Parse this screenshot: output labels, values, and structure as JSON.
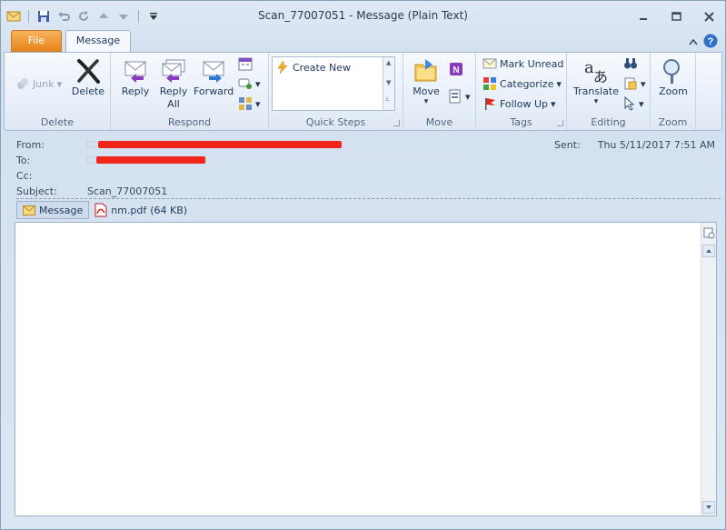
{
  "window": {
    "title": "Scan_77007051  -  Message (Plain Text)"
  },
  "tabs": {
    "file": "File",
    "message": "Message"
  },
  "ribbon": {
    "delete_group": {
      "label": "Delete",
      "junk": "Junk",
      "delete": "Delete"
    },
    "respond_group": {
      "label": "Respond",
      "reply": "Reply",
      "reply_all_1": "Reply",
      "reply_all_2": "All",
      "forward": "Forward"
    },
    "quick_steps_group": {
      "label": "Quick Steps",
      "create_new": "Create New"
    },
    "move_group": {
      "label": "Move",
      "move": "Move"
    },
    "tags_group": {
      "label": "Tags",
      "mark_unread": "Mark Unread",
      "categorize": "Categorize",
      "follow_up": "Follow Up"
    },
    "editing_group": {
      "label": "Editing",
      "translate": "Translate"
    },
    "zoom_group": {
      "label": "Zoom",
      "zoom": "Zoom"
    }
  },
  "header": {
    "from_label": "From:",
    "to_label": "To:",
    "cc_label": "Cc:",
    "subject_label": "Subject:",
    "subject": "Scan_77007051",
    "sent_label": "Sent:",
    "sent_value": "Thu 5/11/2017 7:51 AM"
  },
  "attachments": {
    "message_tab": "Message",
    "file_name": "nm.pdf",
    "file_size": "(64 KB)"
  },
  "colors": {
    "file_tab": "#e8851c",
    "redaction": "#f0261a",
    "accent": "#1e395b"
  }
}
